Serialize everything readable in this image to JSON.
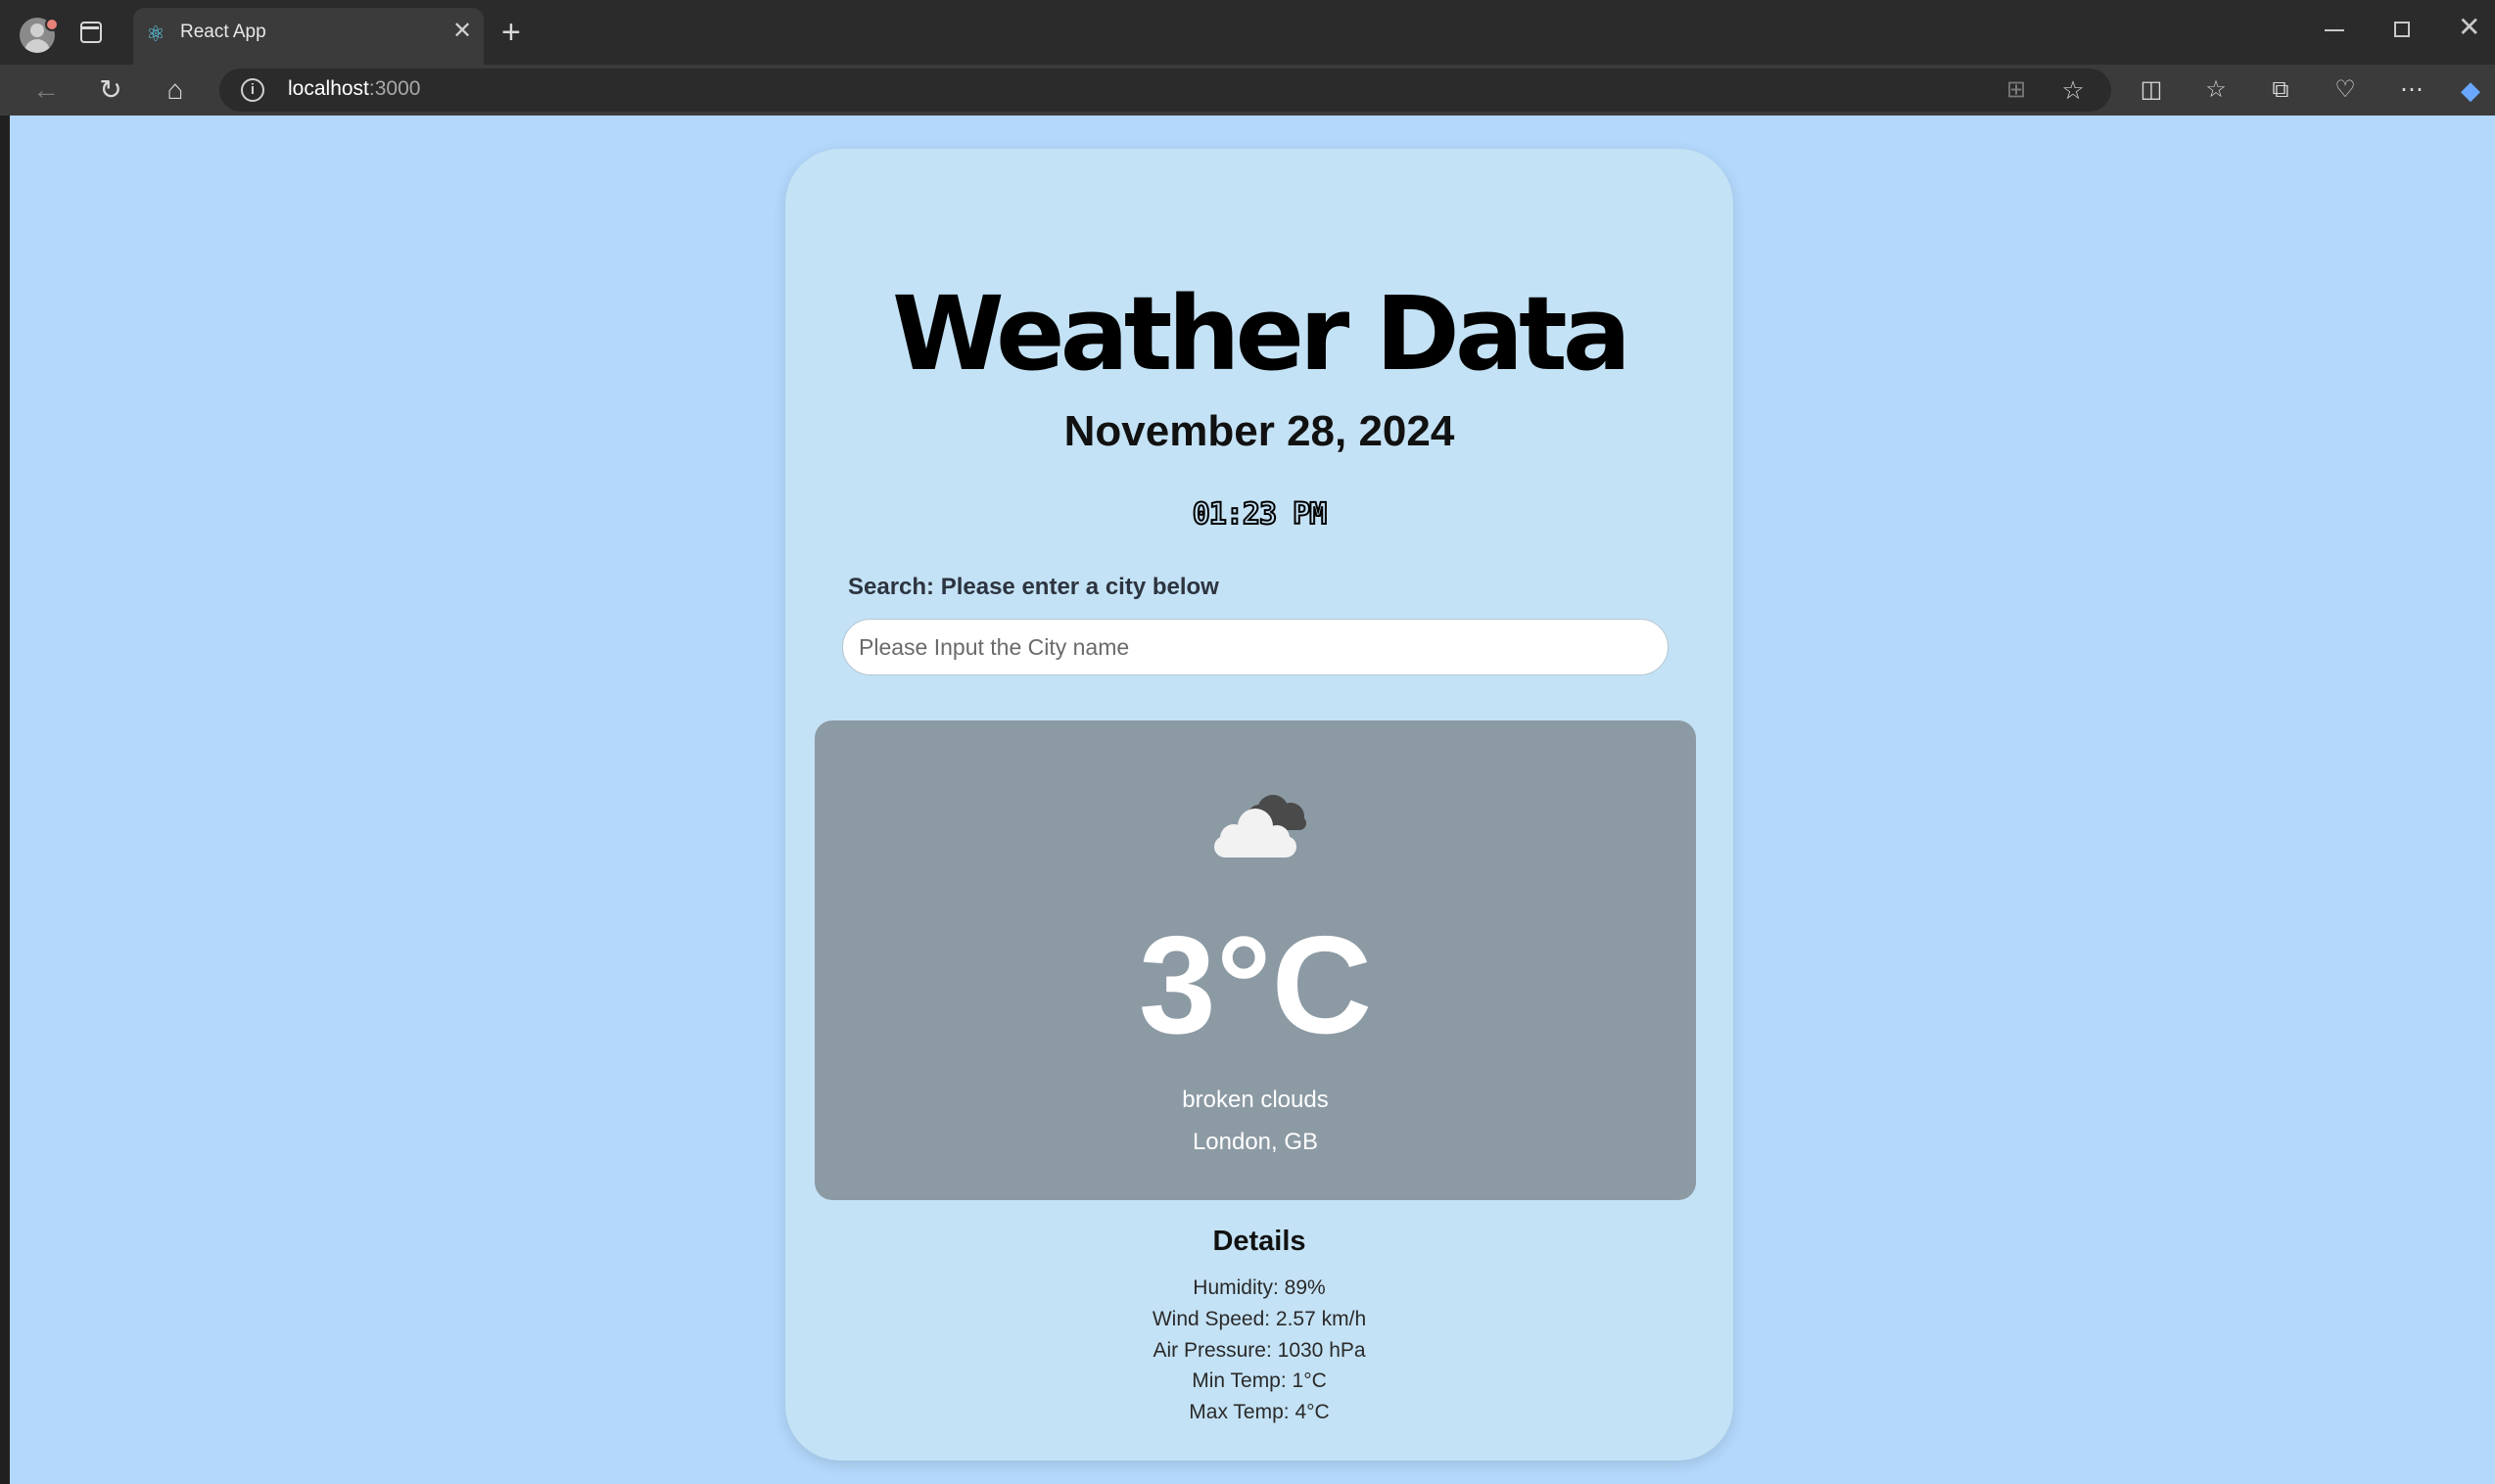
{
  "browser": {
    "tab_title": "React App",
    "url_host": "localhost",
    "url_port": ":3000"
  },
  "app": {
    "title": "Weather Data",
    "date": "November 28, 2024",
    "time": "01:23 PM",
    "search": {
      "label": "Search: Please enter a city below",
      "placeholder": "Please Input the City name",
      "value": ""
    },
    "current": {
      "icon": "broken-clouds-icon",
      "temperature": "3°C",
      "description": "broken clouds",
      "location": "London, GB"
    },
    "details": {
      "heading": "Details",
      "humidity": "Humidity: 89%",
      "wind_speed": "Wind Speed: 2.57 km/h",
      "air_pressure": "Air Pressure: 1030 hPa",
      "min_temp": "Min Temp: 1°C",
      "max_temp": "Max Temp: 4°C"
    }
  },
  "colors": {
    "page_background": "#b3d8fb",
    "card_background": "#c4e2f5",
    "weather_box": "#8c9aa4"
  }
}
